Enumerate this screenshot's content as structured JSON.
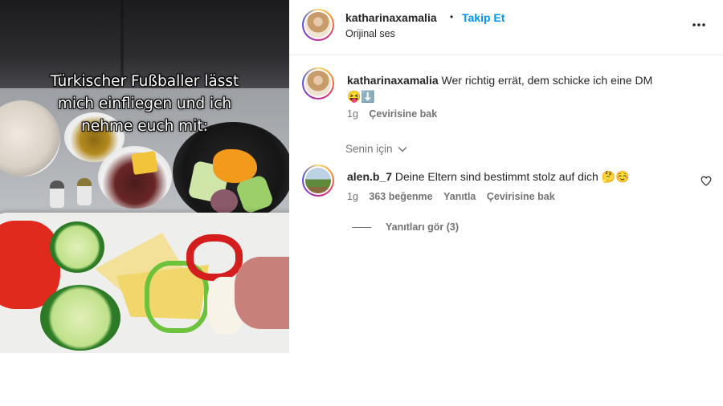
{
  "media": {
    "overlay_lines": [
      "Türkischer Fußballer lässt",
      "mich einfliegen und ich",
      "nehme euch mit:"
    ]
  },
  "header": {
    "username": "katharinaxamalia",
    "separator": "•",
    "follow_label": "Takip Et",
    "audio_label": "Orijinal ses",
    "more_icon": "more-horizontal-icon"
  },
  "caption": {
    "username": "katharinaxamalia",
    "text": "Wer richtig errät, dem schicke ich eine DM",
    "emojis": "😝⬇️",
    "age": "1g",
    "translate_label": "Çevirisine bak"
  },
  "for_you_label": "Senin için",
  "comment": {
    "username": "alen.b_7",
    "text": "Deine Eltern sind bestimmt stolz auf dich",
    "emojis": "🤔☺️",
    "age": "1g",
    "likes": "363 beğenme",
    "reply_label": "Yanıtla",
    "translate_label": "Çevirisine bak",
    "view_replies_label": "Yanıtları gör (3)",
    "like_icon": "heart-icon"
  }
}
